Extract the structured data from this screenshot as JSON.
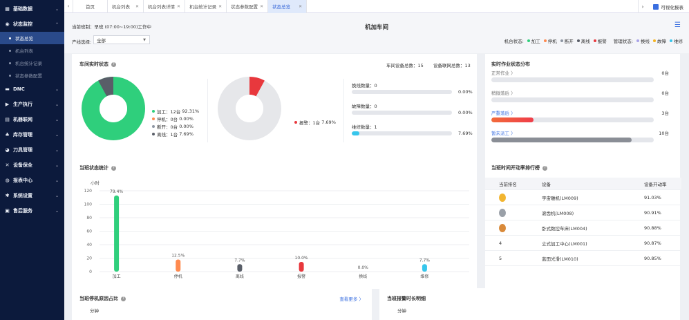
{
  "sidebar": {
    "items": [
      {
        "label": "基础数据",
        "icon": "grid-icon",
        "chev": "⌄"
      },
      {
        "label": "状态监控",
        "icon": "location-icon",
        "chev": "⌃"
      },
      {
        "label": "DNC",
        "icon": "folder-icon",
        "chev": "⌄"
      },
      {
        "label": "生产执行",
        "icon": "play-icon",
        "chev": "⌄"
      },
      {
        "label": "机器联网",
        "icon": "network-icon",
        "chev": "⌄"
      },
      {
        "label": "库存管理",
        "icon": "boxes-icon",
        "chev": "⌄"
      },
      {
        "label": "刀具管理",
        "icon": "tool-icon",
        "chev": "⌄"
      },
      {
        "label": "设备保全",
        "icon": "wrench-icon",
        "chev": "⌄"
      },
      {
        "label": "报表中心",
        "icon": "report-icon",
        "chev": "⌄"
      },
      {
        "label": "系统设置",
        "icon": "gear-icon",
        "chev": "⌄"
      },
      {
        "label": "售后服务",
        "icon": "service-icon",
        "chev": "⌄"
      }
    ],
    "sub_items": [
      "状态总览",
      "机台列表",
      "机台统计记录",
      "状态参数配置"
    ]
  },
  "tabs": [
    {
      "label": "首页"
    },
    {
      "label": "机台列表"
    },
    {
      "label": "机台列表详情"
    },
    {
      "label": "机台统计记录"
    },
    {
      "label": "状态参数配置"
    },
    {
      "label": "状态总览"
    }
  ],
  "tab_close": "✕",
  "tab_left_arrow": "‹",
  "tab_right_arrow": "›",
  "visual_report": "可视化报表",
  "header": {
    "shift": "当前班制：早班 (07:00~19:00)工作中",
    "title": "机加车间",
    "line_label": "产线选择:",
    "line_value": "全部",
    "machine_status_label": "机台状态:",
    "machine_statuses": [
      {
        "label": "加工",
        "color": "#2fcf7c"
      },
      {
        "label": "停机",
        "color": "#ff8a4f"
      },
      {
        "label": "断开",
        "color": "#8e96a3"
      },
      {
        "label": "离线",
        "color": "#595e68"
      },
      {
        "label": "报警",
        "color": "#e8383d"
      }
    ],
    "manage_status_label": "管理状态:",
    "manage_statuses": [
      {
        "label": "换线",
        "color": "#a9a3e8"
      },
      {
        "label": "故障",
        "color": "#f5b321"
      },
      {
        "label": "维修",
        "color": "#37c6ec"
      }
    ]
  },
  "realtime": {
    "title": "车间实时状态",
    "total_label": "车间设备总数：15",
    "network_label": "设备联网总数：13",
    "donut1": [
      {
        "label": "加工：12台",
        "pct": "92.31%",
        "value": 12,
        "color": "#2fcf7c"
      },
      {
        "label": "停机：0台",
        "pct": "0.00%",
        "value": 0,
        "color": "#ff8a4f"
      },
      {
        "label": "断开：0台",
        "pct": "0.00%",
        "value": 0,
        "color": "#8e96a3"
      },
      {
        "label": "离线：1台",
        "pct": "7.69%",
        "value": 1,
        "color": "#595e68"
      }
    ],
    "donut2": {
      "label": "报警：1台",
      "pct": "7.69%",
      "fraction": 0.0769,
      "color": "#e8383d"
    },
    "bars": [
      {
        "label": "换线数量：0",
        "pct": "0.00%",
        "fraction": 0,
        "color": "#a9a3e8"
      },
      {
        "label": "故障数量：0",
        "pct": "0.00%",
        "fraction": 0,
        "color": "#f5b321"
      },
      {
        "label": "维修数量：1",
        "pct": "7.69%",
        "fraction": 0.0769,
        "color": "#37c6ec"
      }
    ]
  },
  "distribution": {
    "title": "实时作业状态分布",
    "rows": [
      {
        "label": "正常作业 〉",
        "value": "0台",
        "fraction": 0,
        "color": "#c8ccd4",
        "label_color": "#777"
      },
      {
        "label": "稍微落后 〉",
        "value": "0台",
        "fraction": 0,
        "color": "#c8ccd4",
        "label_color": "#777"
      },
      {
        "label": "严重落后 〉",
        "value": "3台",
        "fraction": 0.26,
        "color": "#ef3e4a",
        "label_color": "#3a6fe0"
      },
      {
        "label": "暂未派工 〉",
        "value": "10台",
        "fraction": 0.77,
        "color": "#8a8e96",
        "label_color": "#3a6fe0"
      }
    ]
  },
  "shift_stats": {
    "title": "当班状态统计",
    "chart_data": {
      "type": "bar",
      "title": "当班状态统计",
      "ylabel": "小时",
      "ylim": [
        0,
        120
      ],
      "yticks": [
        0,
        20,
        40,
        60,
        80,
        100,
        120
      ],
      "categories": [
        "加工",
        "停机",
        "离线",
        "报警",
        "换线",
        "维修"
      ],
      "values": [
        113,
        18,
        11,
        14.4,
        0,
        11
      ],
      "labels": [
        "79.4%",
        "12.5%",
        "7.7%",
        "10.0%",
        "0.0%",
        "7.7%"
      ],
      "colors": [
        "#2fcf7c",
        "#ff8a4f",
        "#595e68",
        "#e8383d",
        "#a9a3e8",
        "#37c6ec"
      ],
      "grid": true
    }
  },
  "ranking": {
    "title": "当班时间开动率排行榜",
    "headers": [
      "当前排名",
      "设备",
      "设备开动率"
    ],
    "rows": [
      {
        "rank": "",
        "medal": "#f2b530",
        "device": "宇宙雕机(LM009)",
        "rate": "91.03%"
      },
      {
        "rank": "",
        "medal": "#9aa0a8",
        "device": "滚齿机(LM008)",
        "rate": "90.91%"
      },
      {
        "rank": "",
        "medal": "#d98a3a",
        "device": "卧式数控车床(LM004)",
        "rate": "90.88%"
      },
      {
        "rank": "4",
        "medal": "",
        "device": "立式加工中心(LM001)",
        "rate": "90.87%"
      },
      {
        "rank": "5",
        "medal": "",
        "device": "蓝田光滑(LM010)",
        "rate": "90.85%"
      }
    ]
  },
  "stop_reason": {
    "title": "当班停机原因占比",
    "more": "查看更多 〉",
    "unit": "分钟"
  },
  "alarm_duration": {
    "title": "当班报警时长明细",
    "unit": "分钟"
  }
}
